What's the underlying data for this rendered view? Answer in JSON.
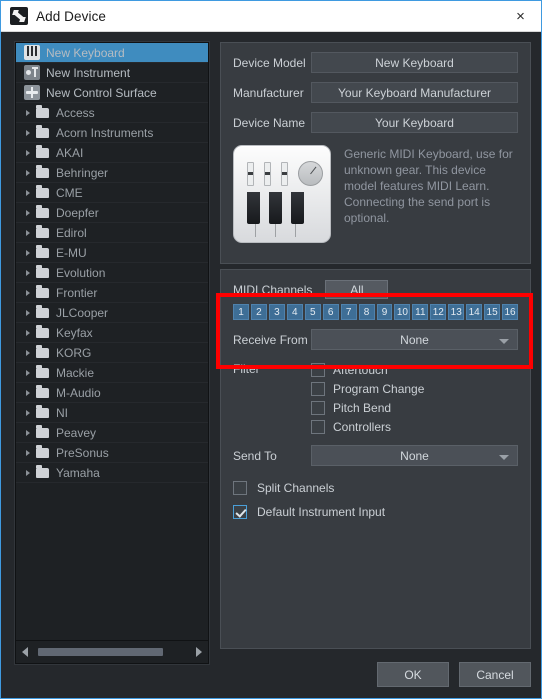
{
  "window": {
    "title": "Add Device",
    "app_icon": "app-logo-icon",
    "close_label": "×"
  },
  "tree": {
    "special_items": [
      {
        "label": "New Keyboard",
        "icon": "keyboard-icon",
        "selected": true
      },
      {
        "label": "New Instrument",
        "icon": "instrument-icon",
        "selected": false
      },
      {
        "label": "New Control Surface",
        "icon": "control-surface-icon",
        "selected": false
      }
    ],
    "vendors": [
      "Access",
      "Acorn Instruments",
      "AKAI",
      "Behringer",
      "CME",
      "Doepfer",
      "Edirol",
      "E-MU",
      "Evolution",
      "Frontier",
      "JLCooper",
      "Keyfax",
      "KORG",
      "Mackie",
      "M-Audio",
      "NI",
      "Peavey",
      "PreSonus",
      "Yamaha"
    ],
    "scrollbar": {
      "left_arrow": "scroll-left-icon",
      "right_arrow": "scroll-right-icon"
    }
  },
  "device": {
    "fields": [
      {
        "label": "Device Model",
        "value": "New Keyboard"
      },
      {
        "label": "Manufacturer",
        "value": "Your Keyboard Manufacturer"
      },
      {
        "label": "Device Name",
        "value": "Your Keyboard"
      }
    ],
    "description": "Generic MIDI Keyboard, use for unknown gear. This device model features MIDI Learn. Connecting the send port is optional.",
    "image_alt": "midi-keyboard-device-image"
  },
  "midi": {
    "channels_label": "MIDI Channels",
    "all_label": "All",
    "channels": [
      "1",
      "2",
      "3",
      "4",
      "5",
      "6",
      "7",
      "8",
      "9",
      "10",
      "11",
      "12",
      "13",
      "14",
      "15",
      "16"
    ],
    "receive_from": {
      "label": "Receive From",
      "value": "None"
    },
    "filter": {
      "label": "Filter",
      "options": [
        {
          "label": "Aftertouch",
          "checked": false
        },
        {
          "label": "Program Change",
          "checked": false
        },
        {
          "label": "Pitch Bend",
          "checked": false
        },
        {
          "label": "Controllers",
          "checked": false
        }
      ]
    },
    "send_to": {
      "label": "Send To",
      "value": "None"
    },
    "extra_options": [
      {
        "label": "Split Channels",
        "checked": false
      },
      {
        "label": "Default Instrument Input",
        "checked": true
      }
    ]
  },
  "footer": {
    "ok_label": "OK",
    "cancel_label": "Cancel"
  },
  "colors": {
    "selection_blue": "#3f8cbf",
    "channel_blue": "#3e6e96",
    "highlight_red": "#ff0000",
    "window_border": "#3f9ae0",
    "panel_bg": "#383c41",
    "tree_bg": "#1e2124"
  }
}
